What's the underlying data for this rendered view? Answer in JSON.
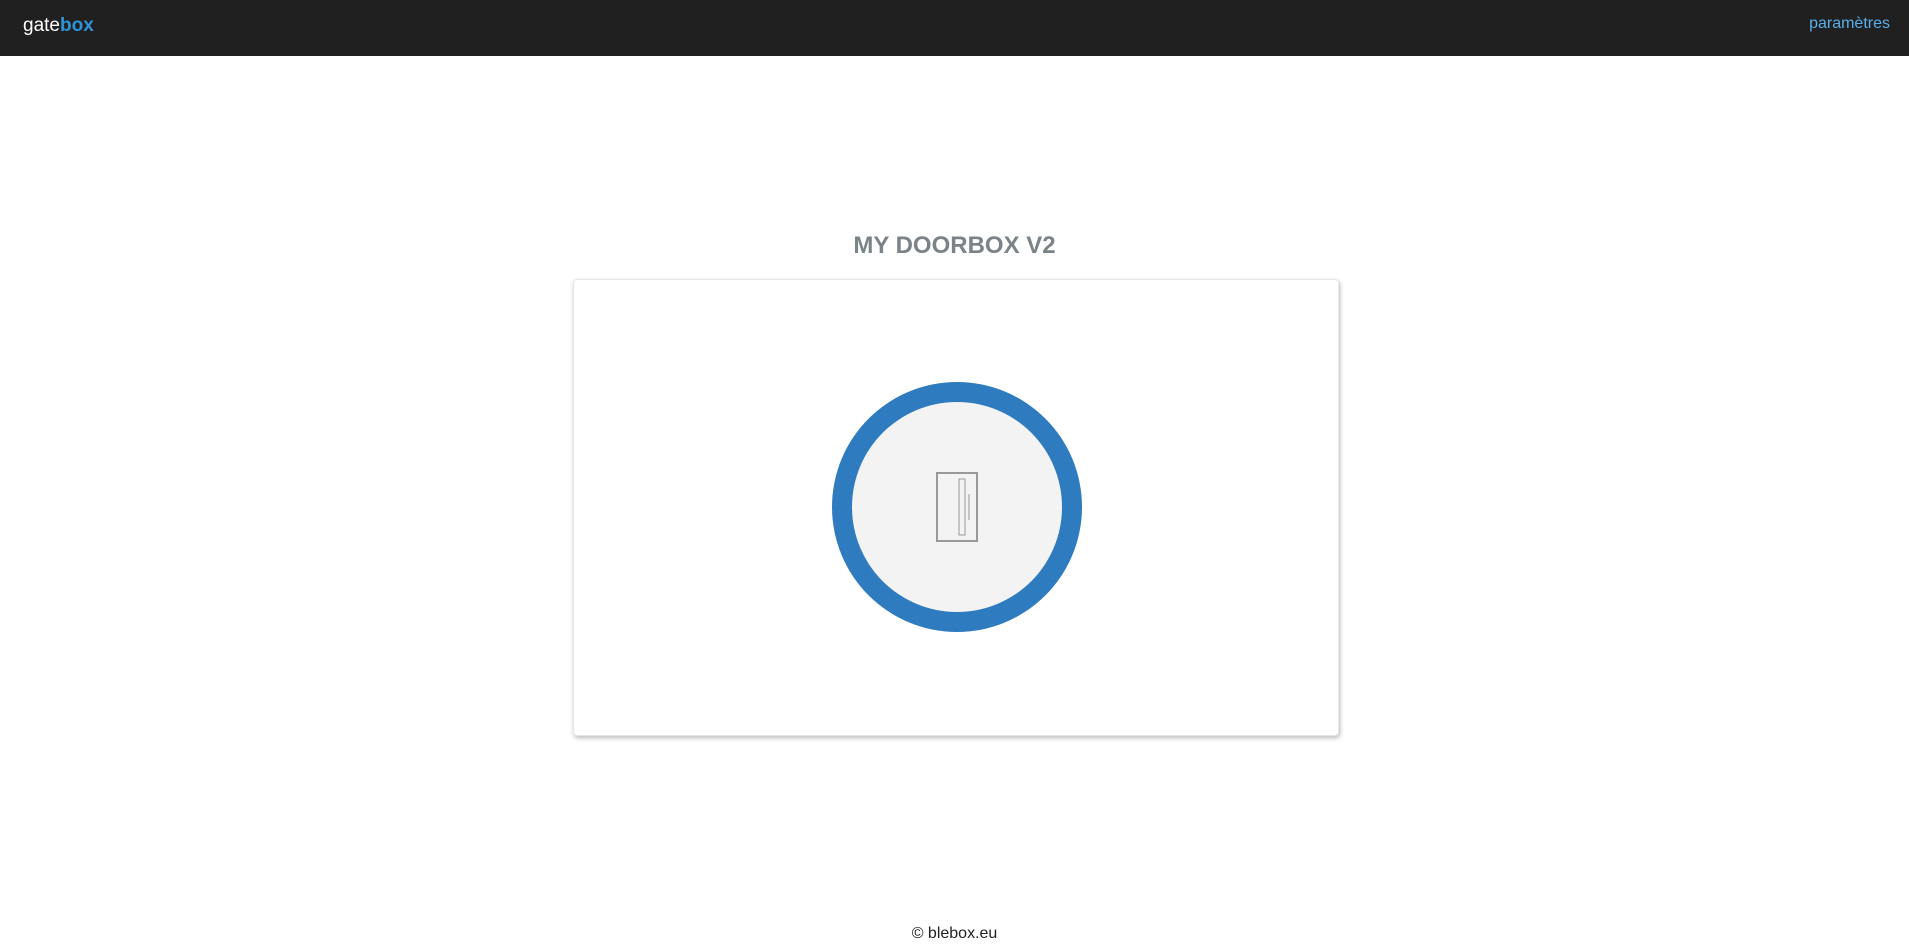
{
  "header": {
    "brand_prefix": "gate",
    "brand_suffix": "box",
    "settings_label": "paramètres"
  },
  "device": {
    "title": "MY DOORBOX V2"
  },
  "gate_button": {
    "icon": "door-icon",
    "ring_color": "#2f7bbf",
    "face_color": "#f3f3f3"
  },
  "footer": {
    "copyright": "© blebox.eu"
  },
  "colors": {
    "topbar": "#202020",
    "brand_accent": "#2f93d8",
    "link": "#5aaee9",
    "title": "#7a8488"
  }
}
